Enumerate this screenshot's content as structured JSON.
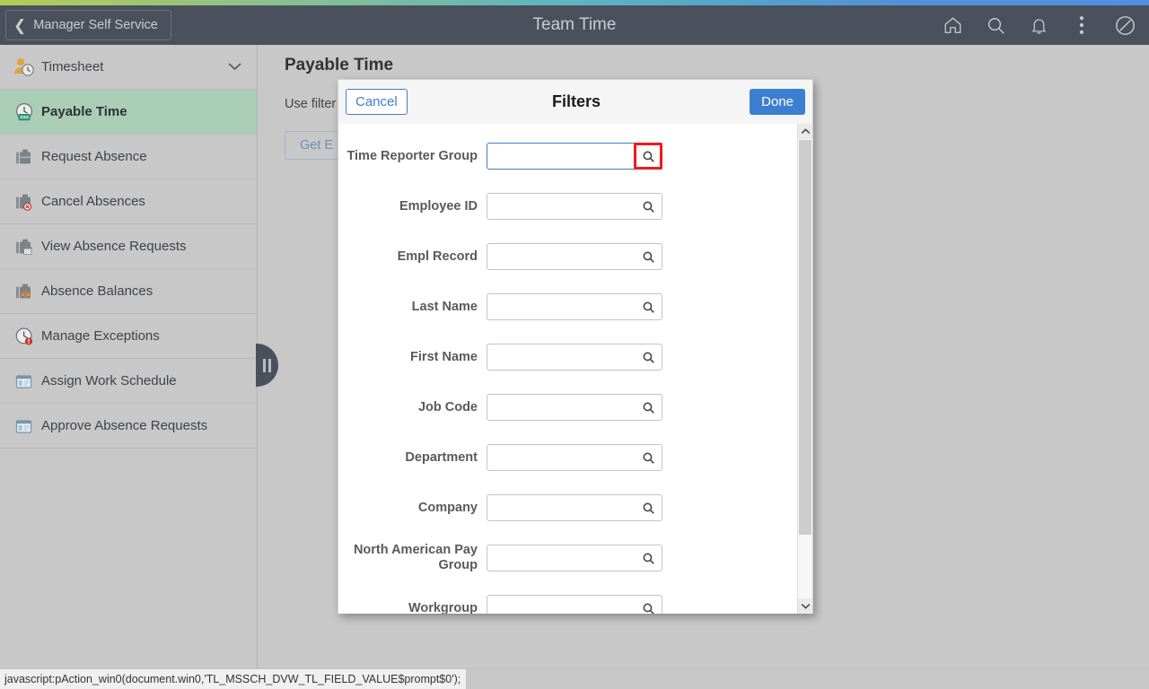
{
  "header": {
    "back_label": "Manager Self Service",
    "back_icon": "chevron-left-icon",
    "title": "Team Time",
    "icons": [
      {
        "name": "home-icon",
        "label": "Home"
      },
      {
        "name": "search-icon",
        "label": "Search"
      },
      {
        "name": "bell-icon",
        "label": "Notifications"
      },
      {
        "name": "kebab-menu-icon",
        "label": "Actions"
      },
      {
        "name": "navbar-icon",
        "label": "NavBar"
      }
    ],
    "accent_gradient": [
      "#b4cc54",
      "#5fb6bf",
      "#4f8fe0"
    ],
    "bar_color": "#4a515c"
  },
  "sidebar": {
    "collapse_handle": "collapse-sidebar-handle",
    "items": [
      {
        "label": "Timesheet",
        "icon": "person-clock-icon",
        "active": false,
        "chevron": "chevron-down-icon"
      },
      {
        "label": "Payable Time",
        "icon": "clock-money-icon",
        "active": true
      },
      {
        "label": "Request Absence",
        "icon": "briefcase-icon",
        "active": false
      },
      {
        "label": "Cancel Absences",
        "icon": "briefcase-cancel-icon",
        "active": false
      },
      {
        "label": "View Absence Requests",
        "icon": "briefcase-calendar-icon",
        "active": false
      },
      {
        "label": "Absence Balances",
        "icon": "briefcase-balance-icon",
        "active": false
      },
      {
        "label": "Manage Exceptions",
        "icon": "clock-alert-icon",
        "active": false
      },
      {
        "label": "Assign Work Schedule",
        "icon": "window-panel-icon",
        "active": false
      },
      {
        "label": "Approve Absence Requests",
        "icon": "window-panel-icon",
        "active": false
      }
    ],
    "active_color": "#a9cdb5"
  },
  "main": {
    "page_title": "Payable Time",
    "description": "Use filter                                                                             rch Options.",
    "get_button_label": "Get E"
  },
  "modal": {
    "title": "Filters",
    "cancel_label": "Cancel",
    "done_label": "Done",
    "done_color": "#3c7fd0",
    "highlight_color": "#f01a1a",
    "fields": [
      {
        "label": "Time Reporter Group",
        "value": "",
        "placeholder": "",
        "lookup_icon": "search-icon",
        "focused": true,
        "highlighted": true
      },
      {
        "label": "Employee ID",
        "value": "",
        "placeholder": "",
        "lookup_icon": "search-icon",
        "focused": false,
        "highlighted": false
      },
      {
        "label": "Empl Record",
        "value": "",
        "placeholder": "",
        "lookup_icon": "search-icon",
        "focused": false,
        "highlighted": false
      },
      {
        "label": "Last Name",
        "value": "",
        "placeholder": "",
        "lookup_icon": "search-icon",
        "focused": false,
        "highlighted": false
      },
      {
        "label": "First Name",
        "value": "",
        "placeholder": "",
        "lookup_icon": "search-icon",
        "focused": false,
        "highlighted": false
      },
      {
        "label": "Job Code",
        "value": "",
        "placeholder": "",
        "lookup_icon": "search-icon",
        "focused": false,
        "highlighted": false
      },
      {
        "label": "Department",
        "value": "",
        "placeholder": "",
        "lookup_icon": "search-icon",
        "focused": false,
        "highlighted": false
      },
      {
        "label": "Company",
        "value": "",
        "placeholder": "",
        "lookup_icon": "search-icon",
        "focused": false,
        "highlighted": false
      },
      {
        "label": "North American Pay Group",
        "value": "",
        "placeholder": "",
        "lookup_icon": "search-icon",
        "focused": false,
        "highlighted": false
      },
      {
        "label": "Workgroup",
        "value": "",
        "placeholder": "",
        "lookup_icon": "search-icon",
        "focused": false,
        "highlighted": false
      }
    ],
    "scrollbar": {
      "up_icon": "chevron-up-icon",
      "down_icon": "chevron-down-icon"
    }
  },
  "statusbar": {
    "text": "javascript:pAction_win0(document.win0,'TL_MSSCH_DVW_TL_FIELD_VALUE$prompt$0');"
  }
}
